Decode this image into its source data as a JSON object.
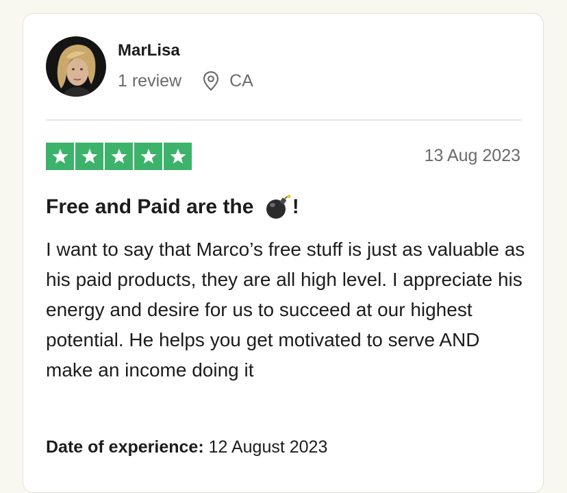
{
  "reviewer": {
    "name": "MarLisa",
    "review_count": "1 review",
    "location": "CA",
    "location_icon": "location-pin-icon",
    "avatar": "avatar"
  },
  "review": {
    "rating": 5,
    "max_rating": 5,
    "date": "13 Aug 2023",
    "title_text": "Free and Paid are the ",
    "title_emoji_icon": "bomb-icon",
    "title_suffix": "!",
    "body": "I want to say that Marco’s free stuff is just as valuable as his paid products, they are all high level. I appreciate his energy and desire for us to succeed at our highest potential. He helps you get motivated to serve AND make an income doing it",
    "experience_label": "Date of experience:",
    "experience_date": "12 August 2023"
  },
  "colors": {
    "star_background": "#3cb26b",
    "page_background": "#f8f7f0",
    "muted_text": "#6b6b6b"
  }
}
